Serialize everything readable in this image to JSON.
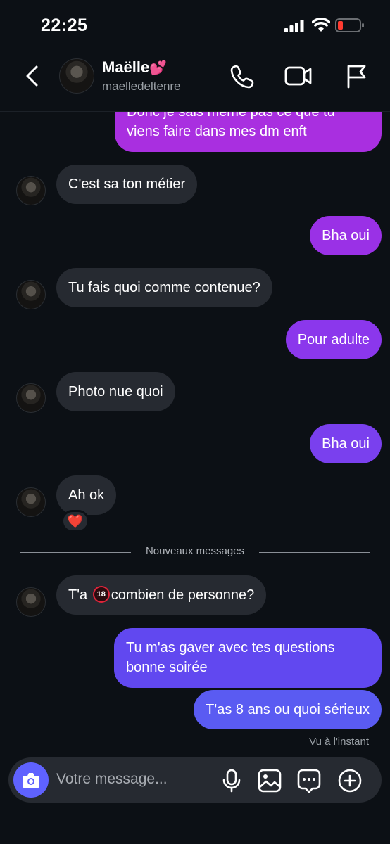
{
  "status_bar": {
    "time": "22:25"
  },
  "header": {
    "name": "Maëlle",
    "name_emoji": "💕",
    "username": "maelledeltenre",
    "icons": [
      "back-chevron-icon",
      "phone-icon",
      "video-camera-icon",
      "flag-icon"
    ]
  },
  "messages": [
    {
      "from": "me",
      "lines": [
        "Donc je sais même pas ce que tu",
        "viens faire dans mes dm enft"
      ]
    },
    {
      "from": "them",
      "text": "C'est sa ton métier"
    },
    {
      "from": "me",
      "text": "Bha oui"
    },
    {
      "from": "them",
      "text": "Tu fais quoi comme contenue?"
    },
    {
      "from": "me",
      "text": "Pour adulte"
    },
    {
      "from": "them",
      "text": "Photo nue quoi"
    },
    {
      "from": "me",
      "text": "Bha oui"
    },
    {
      "from": "them",
      "text": "Ah ok",
      "reaction": "❤️"
    },
    {
      "divider": "Nouveaux messages"
    },
    {
      "from": "them",
      "text_before": "T'a",
      "badge": "18",
      "text_after": "combien de personne?"
    },
    {
      "from": "me",
      "lines": [
        "Tu m'as gaver avec tes questions",
        "bonne soirée"
      ]
    },
    {
      "from": "me",
      "text": "T'as 8 ans ou quoi sérieux"
    }
  ],
  "seen_status": "Vu à l'instant",
  "composer": {
    "placeholder": "Votre message...",
    "icons": [
      "camera-icon",
      "microphone-icon",
      "image-icon",
      "sticker-chat-icon",
      "add-icon"
    ]
  },
  "colors": {
    "background": "#0c1015",
    "incoming_bubble": "#262a31",
    "outgoing_top": "#a92fe0",
    "outgoing_bottom": "#5a5bf2",
    "accent": "#5f62ff"
  }
}
